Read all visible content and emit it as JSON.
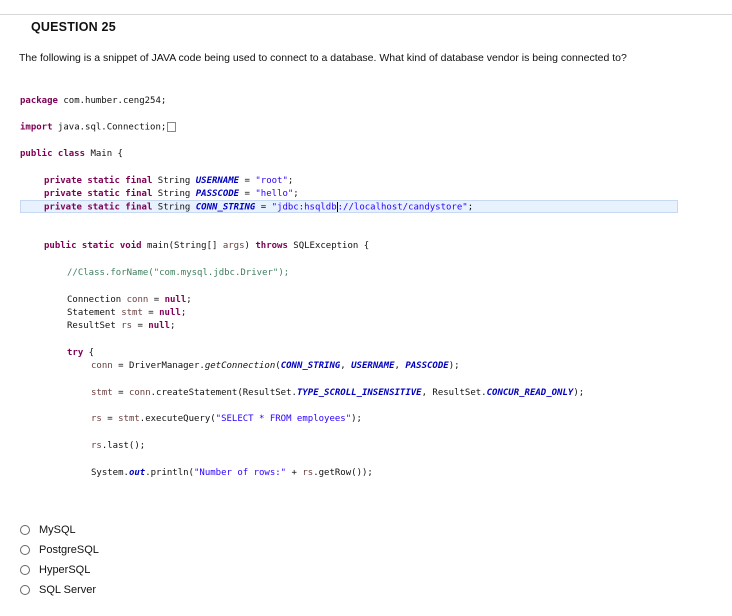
{
  "question": {
    "title": "QUESTION 25",
    "prompt": "The following is a snippet of JAVA code being used to connect to a database.  What kind of database vendor is being connected to?"
  },
  "code": {
    "package_kw": "package",
    "package_name": " com.humber.ceng254;",
    "import_kw": "import",
    "import_name": " java.sql.Connection;",
    "class_mods": "public class",
    "class_name": " Main {",
    "f1_mods": "private static final",
    "f1_type": " String ",
    "f1_name": "USERNAME",
    "f1_eq": " = ",
    "f1_val": "\"root\"",
    "f1_end": ";",
    "f2_mods": "private static final",
    "f2_type": " String ",
    "f2_name": "PASSCODE",
    "f2_eq": " = ",
    "f2_val": "\"hello\"",
    "f2_end": ";",
    "f3_mods": "private static final",
    "f3_type": " String ",
    "f3_name": "CONN_STRING",
    "f3_eq": " = ",
    "f3_val_a": "\"jdbc:hsqldb",
    "f3_val_b": "://localhost/candystore\"",
    "f3_end": ";",
    "main_mods": "public static void",
    "main_sig": " main(String[] ",
    "main_args": "args",
    "main_close": ") ",
    "main_throws": "throws",
    "main_exc": " SQLException {",
    "comment": "//Class.forName(\"com.mysql.jdbc.Driver\");",
    "d1_type": "Connection ",
    "d1_var": "conn",
    "d1_eq": " = ",
    "d1_null": "null",
    "d1_end": ";",
    "d2_type": "Statement ",
    "d2_var": "stmt",
    "d2_eq": " = ",
    "d2_null": "null",
    "d2_end": ";",
    "d3_type": "ResultSet ",
    "d3_var": "rs",
    "d3_eq": " = ",
    "d3_null": "null",
    "d3_end": ";",
    "try_kw": "try",
    "try_brace": " {",
    "s1_var": "conn",
    "s1_a": " = DriverManager.",
    "s1_m": "getConnection",
    "s1_b": "(",
    "s1_f1": "CONN_STRING",
    "s1_c": ", ",
    "s1_f2": "USERNAME",
    "s1_d": ", ",
    "s1_f3": "PASSCODE",
    "s1_e": ");",
    "s2_var1": "stmt",
    "s2_a": " = ",
    "s2_var2": "conn",
    "s2_b": ".createStatement(ResultSet.",
    "s2_f1": "TYPE_SCROLL_INSENSITIVE",
    "s2_c": ", ResultSet.",
    "s2_f2": "CONCUR_READ_ONLY",
    "s2_d": ");",
    "s3_var1": "rs",
    "s3_a": " = ",
    "s3_var2": "stmt",
    "s3_b": ".executeQuery(",
    "s3_str": "\"SELECT * FROM employees\"",
    "s3_c": ");",
    "s4_var": "rs",
    "s4_a": ".last();",
    "s5_a": "System.",
    "s5_out": "out",
    "s5_b": ".println(",
    "s5_str": "\"Number of rows:\"",
    "s5_c": " + ",
    "s5_var": "rs",
    "s5_d": ".getRow());"
  },
  "options": [
    {
      "label": "MySQL"
    },
    {
      "label": "PostgreSQL"
    },
    {
      "label": "HyperSQL"
    },
    {
      "label": "SQL Server"
    }
  ]
}
